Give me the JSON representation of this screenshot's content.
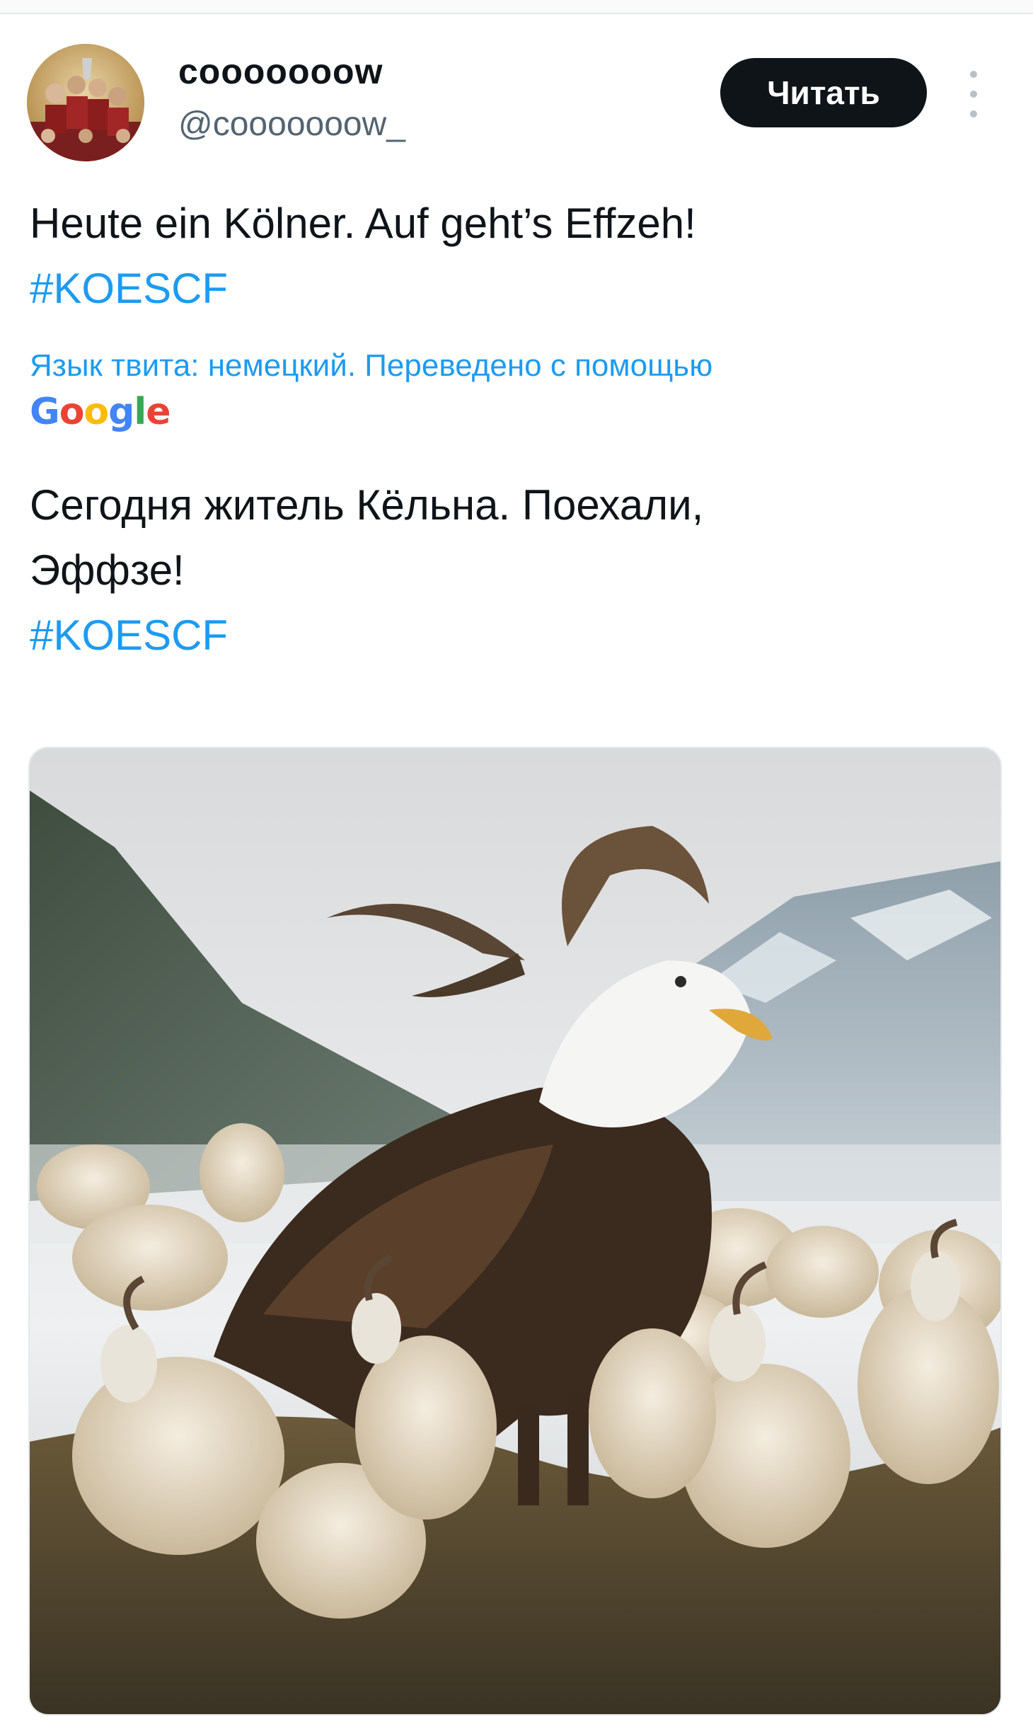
{
  "user": {
    "display_name": "cooooooow",
    "handle": "@cooooooow_"
  },
  "follow_label": "Читать",
  "tweet": {
    "original_text": "Heute ein Kölner. Auf geht’s Effzeh!",
    "original_hashtag": "#KOESCF",
    "translation_note": "Язык твита: немецкий. Переведено с помощью",
    "translator_brand": "Google",
    "translated_line1": "Сегодня житель Кёльна. Поехали,",
    "translated_line2": "Эффзе!",
    "translated_hashtag": "#KOESCF"
  },
  "colors": {
    "link": "#1d9bf0",
    "text": "#0f1419",
    "muted": "#536471",
    "button_bg": "#0f1419"
  },
  "media": {
    "icon": "photo-eagle-goat-hybrid-with-goat-herd"
  }
}
